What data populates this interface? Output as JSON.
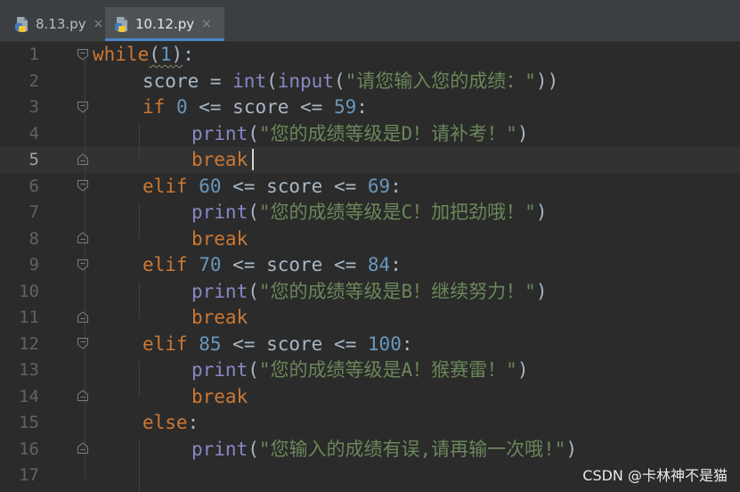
{
  "tabs": [
    {
      "label": "8.13.py",
      "close_glyph": "×",
      "icon": "python-file-icon"
    },
    {
      "label": "10.12.py",
      "close_glyph": "×",
      "icon": "python-file-icon",
      "active": true
    }
  ],
  "line_numbers": [
    "1",
    "2",
    "3",
    "4",
    "5",
    "6",
    "7",
    "8",
    "9",
    "10",
    "11",
    "12",
    "13",
    "14",
    "15",
    "16",
    "17"
  ],
  "current_line": "5",
  "code": {
    "l1": {
      "kw": "while",
      "open": "(",
      "num": "1",
      "close": ")",
      "colon": ":"
    },
    "l2": {
      "var": "score = ",
      "bi1": "int",
      "p1": "(",
      "bi2": "input",
      "p2": "(",
      "str": "\"请您输入您的成绩：\"",
      "p3": "))"
    },
    "l3": {
      "kw": "if",
      "sp": " ",
      "n1": "0",
      "mid": " <= score <= ",
      "n2": "59",
      "colon": ":"
    },
    "l4": {
      "bi": "print",
      "p1": "(",
      "str": "\"您的成绩等级是D！请补考！\"",
      "p2": ")"
    },
    "l5": {
      "kw": "break"
    },
    "l6": {
      "kw": "elif",
      "sp": " ",
      "n1": "60",
      "mid": " <= score <= ",
      "n2": "69",
      "colon": ":"
    },
    "l7": {
      "bi": "print",
      "p1": "(",
      "str": "\"您的成绩等级是C！加把劲哦！\"",
      "p2": ")"
    },
    "l8": {
      "kw": "break"
    },
    "l9": {
      "kw": "elif",
      "sp": " ",
      "n1": "70",
      "mid": " <= score <= ",
      "n2": "84",
      "colon": ":"
    },
    "l10": {
      "bi": "print",
      "p1": "(",
      "str": "\"您的成绩等级是B！继续努力！\"",
      "p2": ")"
    },
    "l11": {
      "kw": "break"
    },
    "l12": {
      "kw": "elif",
      "sp": " ",
      "n1": "85",
      "mid": " <= score <= ",
      "n2": "100",
      "colon": ":"
    },
    "l13": {
      "bi": "print",
      "p1": "(",
      "str": "\"您的成绩等级是A！猴赛雷！\"",
      "p2": ")"
    },
    "l14": {
      "kw": "break"
    },
    "l15": {
      "kw": "else",
      "colon": ":"
    },
    "l16": {
      "bi": "print",
      "p1": "(",
      "str": "\"您输入的成绩有误,请再输一次哦!\"",
      "p2": ")"
    }
  },
  "watermark": "CSDN @卡林神不是猫",
  "colors": {
    "background": "#2b2b2b",
    "keyword": "#cc7832",
    "number": "#6897bb",
    "builtin": "#8888c6",
    "string": "#6a8759",
    "identifier": "#a9b7c6",
    "tab_active_underline": "#4a88c7"
  }
}
